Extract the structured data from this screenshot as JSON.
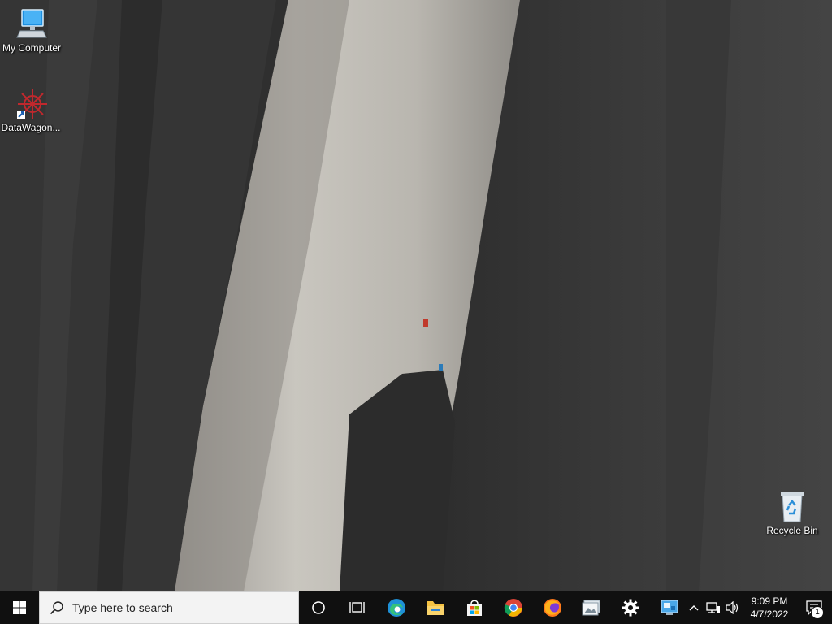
{
  "desktop": {
    "icons": [
      {
        "label": "My Computer",
        "icon": "monitor-icon"
      },
      {
        "label": "DataWagon...",
        "icon": "datawagon-icon"
      },
      {
        "label": "Recycle Bin",
        "icon": "recycle-bin-icon"
      }
    ]
  },
  "taskbar": {
    "search_placeholder": "Type here to search",
    "pinned": [
      {
        "name": "cortana",
        "icon": "cortana-circle-icon"
      },
      {
        "name": "task-view",
        "icon": "task-view-icon"
      },
      {
        "name": "edge",
        "icon": "edge-icon"
      },
      {
        "name": "file-explorer",
        "icon": "folder-icon"
      },
      {
        "name": "store",
        "icon": "store-icon"
      },
      {
        "name": "chrome",
        "icon": "chrome-icon"
      },
      {
        "name": "firefox",
        "icon": "firefox-icon"
      },
      {
        "name": "photos",
        "icon": "photos-icon"
      },
      {
        "name": "settings",
        "icon": "gear-icon"
      },
      {
        "name": "remote-desktop",
        "icon": "remote-desktop-icon"
      }
    ],
    "tray": {
      "time": "9:09 PM",
      "date": "4/7/2022",
      "notification_count": "1"
    }
  },
  "colors": {
    "taskbar_bg": "#101010",
    "search_bg": "#f3f3f3",
    "accent_edge": "#1e90d6",
    "folder_yellow": "#f5c242"
  }
}
